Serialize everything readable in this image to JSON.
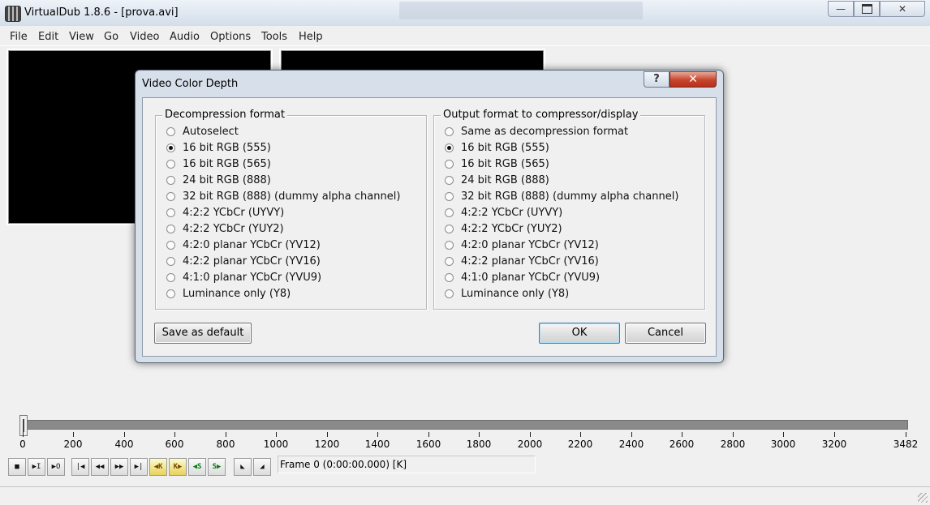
{
  "window": {
    "title": "VirtualDub 1.8.6 - [prova.avi]",
    "min_glyph": "—",
    "close_glyph": "✕"
  },
  "menu": [
    "File",
    "Edit",
    "View",
    "Go",
    "Video",
    "Audio",
    "Options",
    "Tools",
    "Help"
  ],
  "dialog": {
    "title": "Video Color Depth",
    "help_glyph": "?",
    "close_glyph": "✕",
    "left_group": {
      "label": "Decompression format",
      "selected_index": 1,
      "options": [
        "Autoselect",
        "16 bit RGB (555)",
        "16 bit RGB (565)",
        "24 bit RGB (888)",
        "32 bit RGB (888) (dummy alpha channel)",
        "4:2:2 YCbCr (UYVY)",
        "4:2:2 YCbCr (YUY2)",
        "4:2:0 planar YCbCr (YV12)",
        "4:2:2 planar YCbCr (YV16)",
        "4:1:0 planar YCbCr (YVU9)",
        "Luminance only (Y8)"
      ]
    },
    "right_group": {
      "label": "Output format to compressor/display",
      "selected_index": 1,
      "options": [
        "Same as decompression format",
        "16 bit RGB (555)",
        "16 bit RGB (565)",
        "24 bit RGB (888)",
        "32 bit RGB (888) (dummy alpha channel)",
        "4:2:2 YCbCr (UYVY)",
        "4:2:2 YCbCr (YUY2)",
        "4:2:0 planar YCbCr (YV12)",
        "4:2:2 planar YCbCr (YV16)",
        "4:1:0 planar YCbCr (YVU9)",
        "Luminance only (Y8)"
      ]
    },
    "buttons": {
      "save_default": "Save as default",
      "ok": "OK",
      "cancel": "Cancel"
    }
  },
  "timeline": {
    "max_frame": 3482,
    "current_frame": 0,
    "ticks": [
      "0",
      "200",
      "400",
      "600",
      "800",
      "1000",
      "1200",
      "1400",
      "1600",
      "1800",
      "2000",
      "2200",
      "2400",
      "2600",
      "2800",
      "3000",
      "3200",
      "3482"
    ]
  },
  "toolbar": {
    "icons": [
      {
        "name": "stop-icon",
        "glyph": "■"
      },
      {
        "name": "play-input-icon",
        "glyph": "▶I"
      },
      {
        "name": "play-output-icon",
        "glyph": "▶O"
      },
      {
        "name": "go-start-icon",
        "glyph": "|◀"
      },
      {
        "name": "prev-keyframe-icon",
        "glyph": "◀◀"
      },
      {
        "name": "next-keyframe-icon",
        "glyph": "▶▶"
      },
      {
        "name": "go-end-icon",
        "glyph": "▶|"
      },
      {
        "name": "prev-key-icon",
        "glyph": "◀K"
      },
      {
        "name": "next-key-icon",
        "glyph": "K▶"
      },
      {
        "name": "scene-back-icon",
        "glyph": "◀S"
      },
      {
        "name": "scene-forward-icon",
        "glyph": "S▶"
      },
      {
        "name": "mark-in-icon",
        "glyph": "◣"
      },
      {
        "name": "mark-out-icon",
        "glyph": "◢"
      }
    ],
    "frame_text": "Frame 0 (0:00:00.000) [K]"
  }
}
